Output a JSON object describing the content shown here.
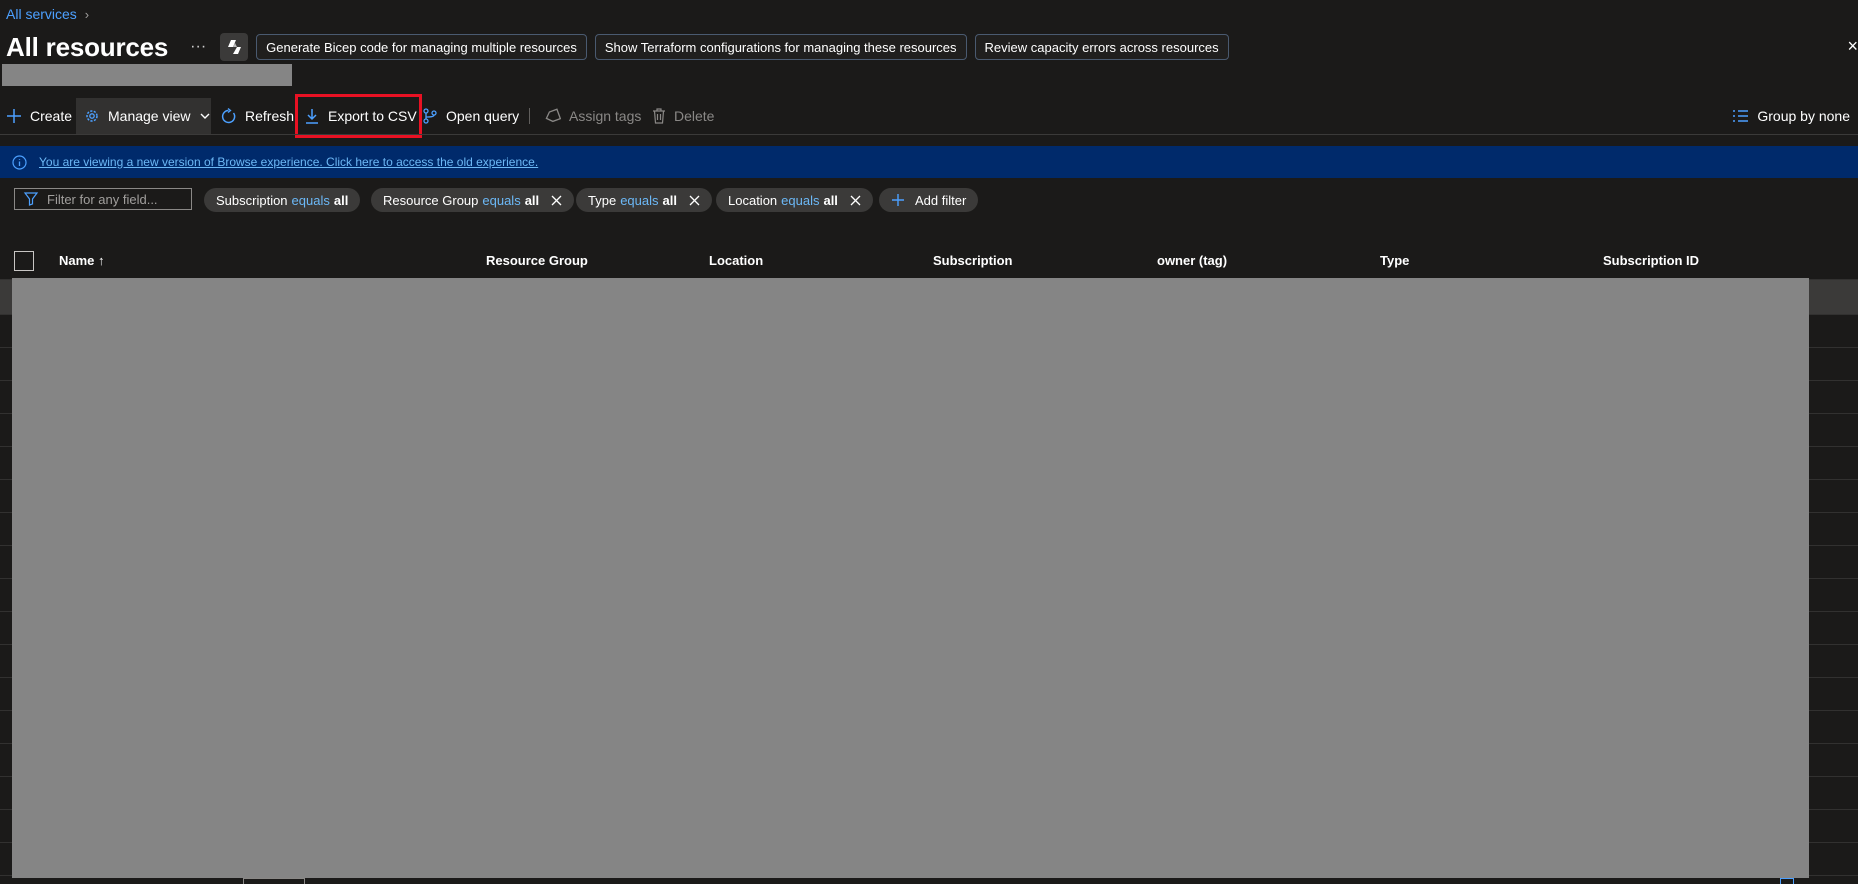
{
  "breadcrumb": {
    "root": "All services",
    "separator": "›"
  },
  "header": {
    "title": "All resources",
    "more": "···",
    "actions": [
      "Generate Bicep code for managing multiple resources",
      "Show Terraform configurations for managing these resources",
      "Review capacity errors across resources"
    ],
    "close": "×"
  },
  "toolbar": {
    "create": "Create",
    "manage_view": "Manage view",
    "refresh": "Refresh",
    "export_csv": "Export to CSV",
    "open_query": "Open query",
    "assign_tags": "Assign tags",
    "delete": "Delete",
    "group_by": "Group by none"
  },
  "banner": {
    "text": "You are viewing a new version of Browse experience. Click here to access the old experience."
  },
  "filters": {
    "search_placeholder": "Filter for any field...",
    "chips": [
      {
        "field": "Subscription",
        "op": "equals",
        "value": "all"
      },
      {
        "field": "Resource Group",
        "op": "equals",
        "value": "all"
      },
      {
        "field": "Type",
        "op": "equals",
        "value": "all"
      },
      {
        "field": "Location",
        "op": "equals",
        "value": "all"
      }
    ],
    "add_filter": "Add filter"
  },
  "table": {
    "columns": [
      "Name ↑",
      "Resource Group",
      "Location",
      "Subscription",
      "owner (tag)",
      "Type",
      "Subscription ID"
    ]
  },
  "colors": {
    "accent": "#4ca0ff",
    "banner_bg": "#002a6b",
    "highlight": "#e81123",
    "background": "#1b1a19"
  }
}
